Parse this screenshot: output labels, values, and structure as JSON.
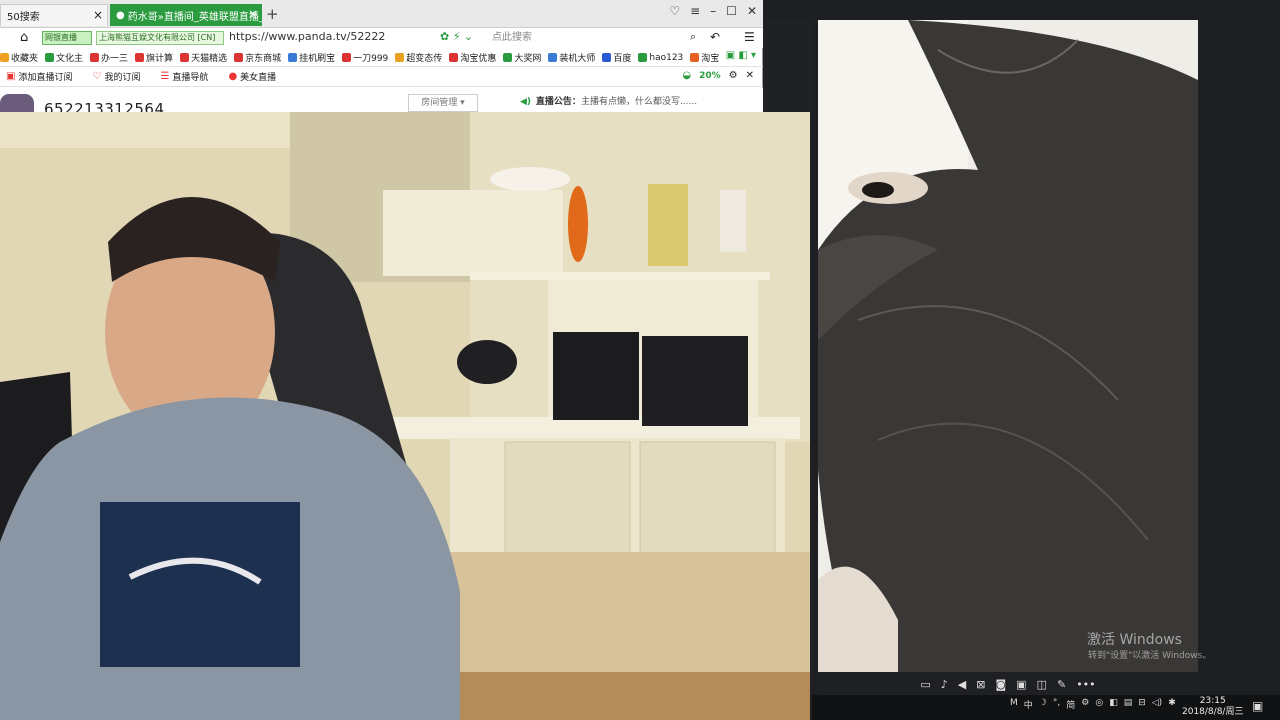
{
  "browser": {
    "tabs": [
      {
        "label": "50搜索"
      },
      {
        "label": "药水哥»直播间_英雄联盟直播_l"
      }
    ],
    "security_badge": "网银直播",
    "cert_badge": "上海熊猫互娱文化有限公司 [CN]",
    "url": "https://www.panda.tv/52222",
    "search_placeholder": "点此搜索",
    "favorites": [
      "收藏夹",
      "文化主",
      "办一三",
      "旗计算",
      "天猫精选",
      "京东商城",
      "挂机刷宝",
      "一刀999",
      "超变态传",
      "淘宝优惠",
      "大奖网",
      "装机大师",
      "百度",
      "hao123",
      "淘宝"
    ],
    "extensions": [
      "添加直播订阅",
      "我的订阅",
      "直播导航",
      "美女直播"
    ],
    "zoom_pct": "20%"
  },
  "page": {
    "room_id": "652213312564",
    "room_manage_label": "房间管理 ▾",
    "notice_label": "直播公告：",
    "notice_text": "主播有点懒，什么都没写......"
  },
  "call": {
    "watermark_title": "激活 Windows",
    "watermark_sub": "转到\"设置\"以激活 Windows。"
  },
  "taskbar": {
    "ime": "中",
    "tray_text": "简",
    "time": "23:15",
    "date": "2018/8/8/周三"
  },
  "colors": {
    "brand_green": "#2a9c3f",
    "taskbar_bg": "#101214"
  }
}
